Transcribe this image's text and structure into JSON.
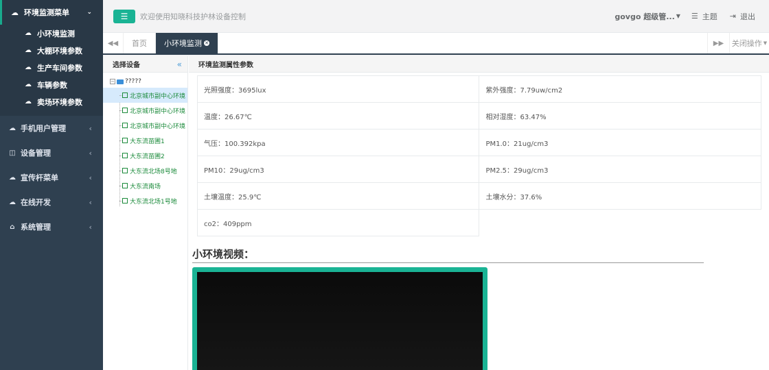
{
  "sidebar": {
    "section_title": "环境监测菜单",
    "sub_items": [
      {
        "label": "小环境监测"
      },
      {
        "label": "大棚环境参数"
      },
      {
        "label": "生产车间参数"
      },
      {
        "label": "车辆参数"
      },
      {
        "label": "卖场环境参数"
      }
    ],
    "menu_items": [
      {
        "label": "手机用户管理",
        "icon": "cloud-icon"
      },
      {
        "label": "设备管理",
        "icon": "columns-icon"
      },
      {
        "label": "宣传杆菜单",
        "icon": "cloud-icon"
      },
      {
        "label": "在线开发",
        "icon": "cloud-icon"
      },
      {
        "label": "系统管理",
        "icon": "home-icon"
      }
    ]
  },
  "topbar": {
    "welcome": "欢迎使用知晓科技护林设备控制",
    "user": "govgo 超级管...",
    "theme": "主题",
    "logout": "退出"
  },
  "tabs": {
    "items": [
      {
        "label": "首页",
        "active": false
      },
      {
        "label": "小环境监测",
        "active": true
      }
    ],
    "close_ops": "关闭操作"
  },
  "device_panel": {
    "title": "选择设备",
    "root": "?????",
    "devices": [
      {
        "label": "北京城市副中心环境",
        "selected": true
      },
      {
        "label": "北京城市副中心环境",
        "selected": false
      },
      {
        "label": "北京城市副中心环境",
        "selected": false
      },
      {
        "label": "大东流苗圃1",
        "selected": false
      },
      {
        "label": "大东流苗圃2",
        "selected": false
      },
      {
        "label": "大东流北场8号地",
        "selected": false
      },
      {
        "label": "大东流南场",
        "selected": false
      },
      {
        "label": "大东流北场1号地",
        "selected": false
      }
    ]
  },
  "attributes": {
    "title": "环境监测属性参数",
    "rows": [
      [
        "光照强度：3695lux",
        "紫外强度：7.79uw/cm2"
      ],
      [
        "温度：26.67℃",
        "相对湿度：63.47%"
      ],
      [
        "气压：100.392kpa",
        "PM1.0：21ug/cm3"
      ],
      [
        "PM10：29ug/cm3",
        "PM2.5：29ug/cm3"
      ],
      [
        "土壤温度：25.9℃",
        "土壤水分：37.6%"
      ],
      [
        "co2：409ppm",
        ""
      ]
    ]
  },
  "video": {
    "title": "小环境视频："
  },
  "colors": {
    "sidebar_bg": "#2f4050",
    "accent": "#1ab394",
    "tree_text": "#1a8a3a"
  }
}
